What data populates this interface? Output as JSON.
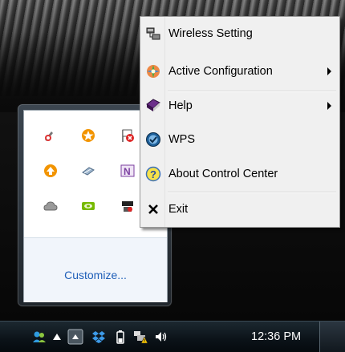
{
  "menu": {
    "items": [
      {
        "label": "Wireless Setting",
        "icon": "wireless-network-icon",
        "submenu": false
      },
      {
        "label": "Active Configuration",
        "icon": "configuration-icon",
        "submenu": true
      },
      {
        "label": "Help",
        "icon": "help-book-icon",
        "submenu": true
      },
      {
        "label": "WPS",
        "icon": "wps-icon",
        "submenu": false
      },
      {
        "label": "About Control Center",
        "icon": "about-question-icon",
        "submenu": false
      },
      {
        "label": "Exit",
        "icon": "exit-x-icon",
        "submenu": false
      }
    ]
  },
  "tray": {
    "customize_label": "Customize...",
    "icons": [
      "network-app-icon",
      "orange-star-icon",
      "flag-error-icon",
      "orange-arrow-icon",
      "network-cable-icon",
      "onenote-icon",
      "cloud-icon",
      "nvidia-icon",
      "network-tool-icon"
    ]
  },
  "taskbar": {
    "clock": "12:36 PM",
    "icons": [
      "people-icon",
      "show-hidden-arrow-icon",
      "action-center-icon",
      "dropbox-icon",
      "battery-icon",
      "network-warning-icon",
      "volume-icon"
    ]
  },
  "colors": {
    "link": "#1e5eb8",
    "taskbar": "#0b1218",
    "menu_bg": "#f0f0f0"
  }
}
